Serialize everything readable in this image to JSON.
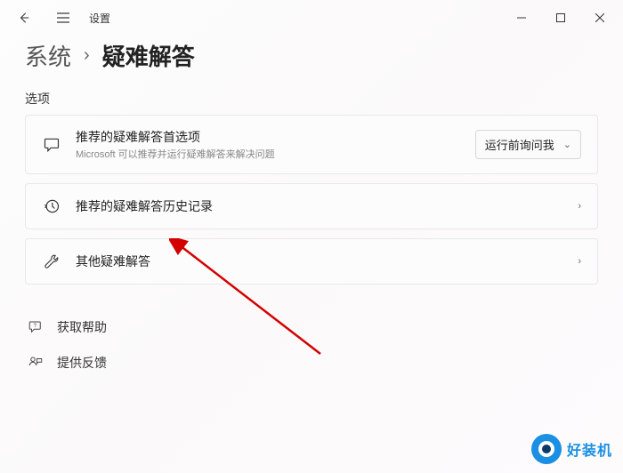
{
  "titlebar": {
    "title": "设置"
  },
  "breadcrumb": {
    "parent": "系统",
    "current": "疑难解答"
  },
  "section_label": "选项",
  "cards": {
    "recommended": {
      "title": "推荐的疑难解答首选项",
      "subtitle": "Microsoft 可以推荐并运行疑难解答来解决问题",
      "dropdown_value": "运行前询问我"
    },
    "history": {
      "title": "推荐的疑难解答历史记录"
    },
    "other": {
      "title": "其他疑难解答"
    }
  },
  "links": {
    "help": "获取帮助",
    "feedback": "提供反馈"
  },
  "watermark": "好装机"
}
